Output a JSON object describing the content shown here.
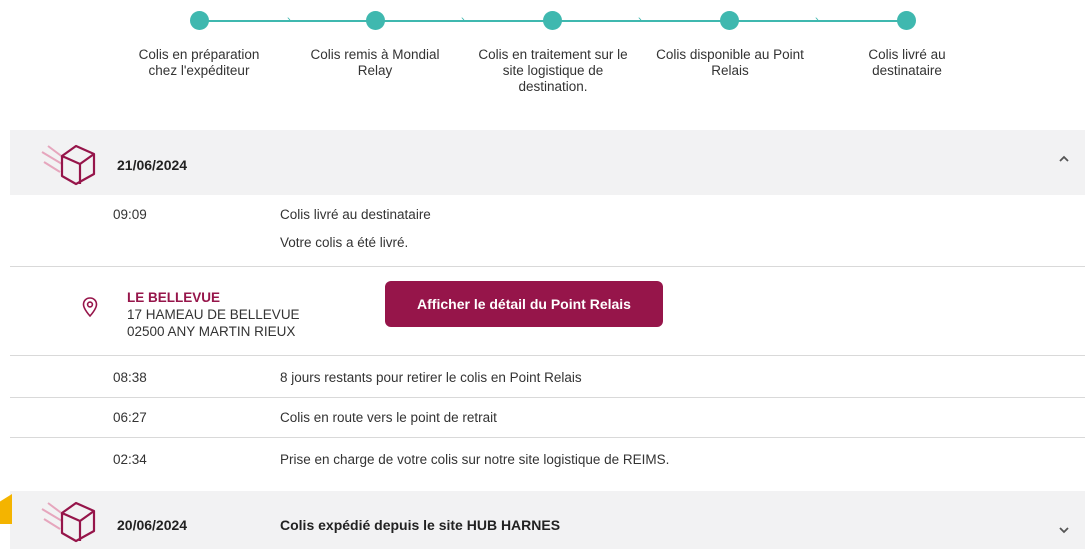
{
  "stepper": {
    "steps": [
      {
        "label": "Colis en préparation chez l'expéditeur"
      },
      {
        "label": "Colis remis à Mondial Relay"
      },
      {
        "label": "Colis en traitement sur le site logistique de destination."
      },
      {
        "label": "Colis disponible au Point Relais"
      },
      {
        "label": "Colis livré au destinataire"
      }
    ]
  },
  "days": [
    {
      "date": "21/06/2024",
      "title": "",
      "expanded": true,
      "events_top": [
        {
          "time": "09:09",
          "text": "Colis livré au destinataire",
          "detail": "Votre colis a été livré."
        }
      ],
      "relay": {
        "name": "LE BELLEVUE",
        "address1": "17 HAMEAU DE BELLEVUE",
        "address2": "02500 ANY MARTIN RIEUX",
        "button_label": "Afficher le détail du Point Relais"
      },
      "events": [
        {
          "time": "08:38",
          "text": "8 jours restants pour retirer le colis en Point Relais"
        },
        {
          "time": "06:27",
          "text": "Colis en route vers le point de retrait"
        },
        {
          "time": "02:34",
          "text": "Prise en charge de votre colis sur notre site logistique de REIMS."
        }
      ]
    },
    {
      "date": "20/06/2024",
      "title": "Colis expédié depuis le site HUB HARNES",
      "expanded": false
    }
  ],
  "colors": {
    "accent": "#3fb8af",
    "brand": "#96154a",
    "header_bg": "#f2f2f3"
  }
}
